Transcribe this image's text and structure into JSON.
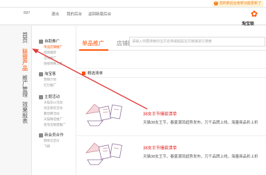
{
  "topbar": {
    "notice": "您的新后台有新功能更新了"
  },
  "header": {
    "account": "697",
    "nav": [
      "退出",
      "我的后台",
      "返回新版后台"
    ],
    "logo": "淘宝联"
  },
  "sidebar": {
    "items": [
      {
        "label": "首页",
        "active": false
      },
      {
        "label": "联盟产品",
        "active": true
      },
      {
        "label": "推广管理",
        "active": false
      },
      {
        "label": "效果报表",
        "active": false
      }
    ]
  },
  "subnav": {
    "groups": [
      {
        "label": "自助推广",
        "links": [
          {
            "label": "单品店铺推广",
            "active": true
          },
          {
            "label": "团购推荐",
            "active": false
          },
          {
            "label": "活动推广",
            "active": false
          },
          {
            "label": "链接转换工具",
            "active": false
          }
        ]
      },
      {
        "label": "淘宝客",
        "links": [
          {
            "label": "营销计划",
            "active": false
          },
          {
            "label": "红包推广",
            "active": false
          }
        ]
      },
      {
        "label": "主题活动",
        "links": [
          {
            "label": "天猫双11活动",
            "active": false
          },
          {
            "label": "淘宝家装活动",
            "active": false
          },
          {
            "label": "聚划算活动",
            "active": false
          },
          {
            "label": "天猫精选推广",
            "active": false
          },
          {
            "label": "爱淘宝联盟推广",
            "active": false
          }
        ]
      },
      {
        "label": "新会员合作",
        "links": [
          {
            "label": "网易云音乐",
            "active": false
          },
          {
            "label": "飞猪",
            "active": false
          }
        ]
      }
    ]
  },
  "main": {
    "tabs": [
      {
        "label": "单品推广",
        "active": true
      },
      {
        "label": "店铺推广",
        "active": false
      }
    ],
    "search_placeholder": "请输入你要搜索的宝贝名称或粘贴宝贝链接进行搜索",
    "section_title": "精选清单",
    "cards": [
      {
        "title": "38女王节爆款清单",
        "desc": "天猫38女王节，春夏潮流趋势发布，万千品牌上线，海量商品折上折"
      },
      {
        "title": "38女王节爆款清单",
        "desc": "天猫38女王节，春夏潮流趋势发布，万千品牌上线，海量商品折上折"
      }
    ]
  },
  "colors": {
    "accent": "#ff5000",
    "title_red": "#e02020",
    "arrow": "#e23a3a"
  }
}
